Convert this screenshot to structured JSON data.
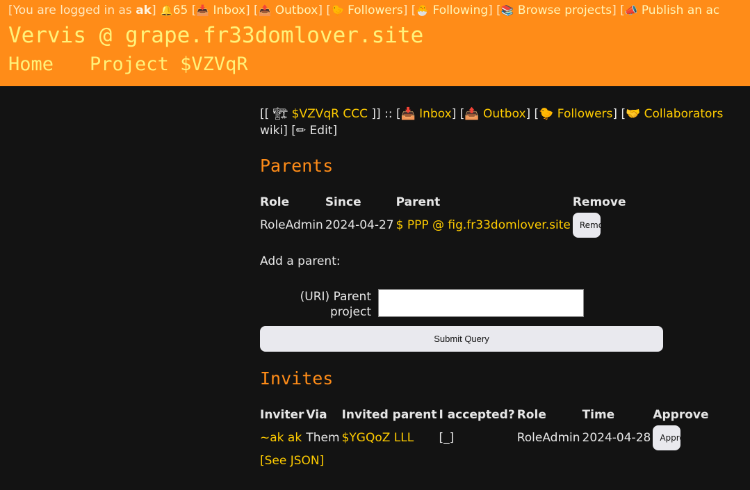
{
  "userbar": {
    "prefix": "[You are logged in as ",
    "username": "ak",
    "close": "]",
    "notif_icon": "🔔",
    "notif_count": "65",
    "links": [
      {
        "icon": "📥",
        "label": "Inbox"
      },
      {
        "icon": "📤",
        "label": "Outbox"
      },
      {
        "icon": "🐤",
        "label": "Followers"
      },
      {
        "icon": "🐣",
        "label": "Following"
      },
      {
        "icon": "📚",
        "label": "Browse projects"
      },
      {
        "icon": "📣",
        "label": "Publish an ac"
      }
    ]
  },
  "site": {
    "title": "Vervis @ grape.fr33domlover.site"
  },
  "breadcrumbs": {
    "home": "Home",
    "project": "Project $VZVqR"
  },
  "projnav": {
    "open": "[[",
    "project_icon": "🏗",
    "project_link": "$VZVqR CCC",
    "close": "]] ::",
    "links": [
      {
        "icon": "📥",
        "label": "Inbox"
      },
      {
        "icon": "📤",
        "label": "Outbox"
      },
      {
        "icon": "🐤",
        "label": "Followers"
      },
      {
        "icon": "🤝",
        "label": "Collaborators"
      }
    ],
    "wiki": "wiki]",
    "edit_icon": "✏",
    "edit": "Edit"
  },
  "parents": {
    "heading": "Parents",
    "columns": [
      "Role",
      "Since",
      "Parent",
      "Remove"
    ],
    "rows": [
      {
        "role": "RoleAdmin",
        "since": "2024-04-27",
        "parent": "$ PPP @ fig.fr33domlover.site",
        "remove_label": "Remove"
      }
    ],
    "add_label": "Add a parent:",
    "uri_label": "(URI) Parent project",
    "uri_value": "",
    "submit_label": "Submit Query"
  },
  "invites": {
    "heading": "Invites",
    "columns": [
      "Inviter",
      "Via",
      "Invited parent",
      "I accepted?",
      "Role",
      "Time",
      "Approve"
    ],
    "rows": [
      {
        "inviter": "~ak ak",
        "via": "Them",
        "invited_parent": "$YGQoZ LLL",
        "accepted": "[_]",
        "role": "RoleAdmin",
        "time": "2024-04-28",
        "approve_label": "Approve"
      }
    ],
    "see_json": "[See JSON]"
  },
  "colors": {
    "header_bg": "#ff8c18",
    "page_bg": "#131313",
    "link": "#ffcc00",
    "heading": "#ff8c18"
  }
}
